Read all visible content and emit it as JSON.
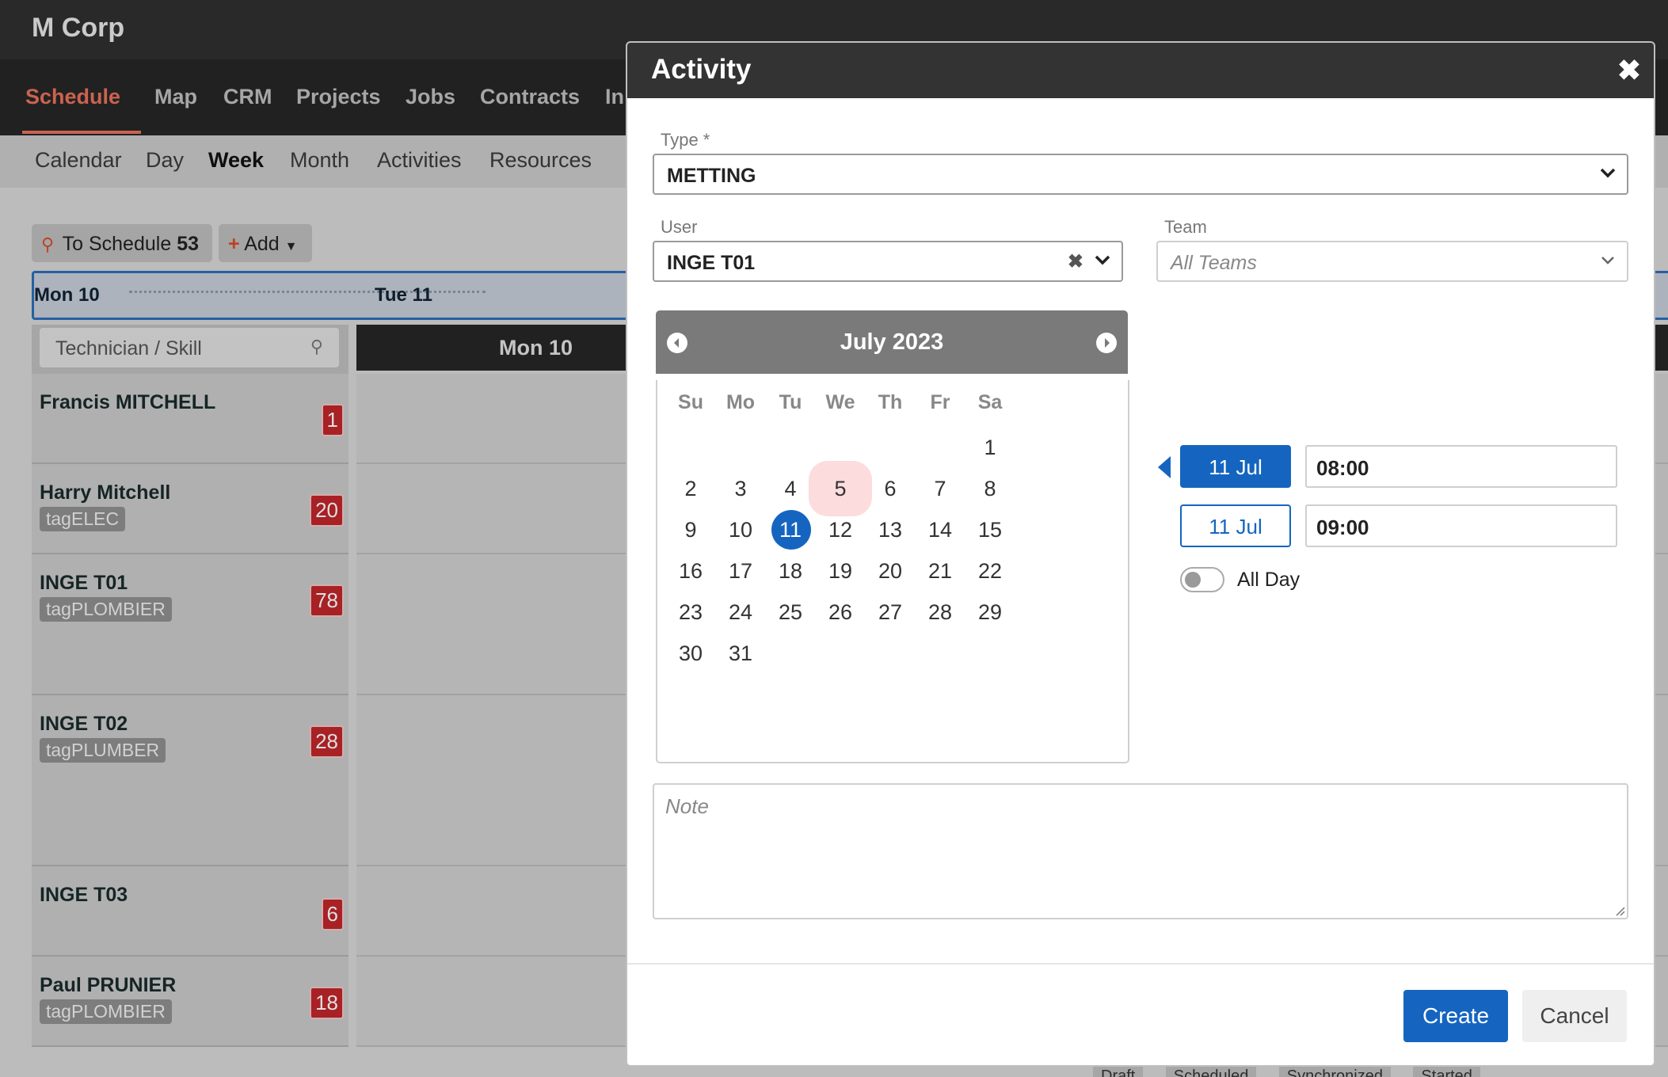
{
  "app": {
    "brand": "M Corp"
  },
  "main_nav": [
    {
      "label": "Schedule",
      "active": true
    },
    {
      "label": "Map"
    },
    {
      "label": "CRM"
    },
    {
      "label": "Projects"
    },
    {
      "label": "Jobs"
    },
    {
      "label": "Contracts"
    },
    {
      "label": "In"
    }
  ],
  "sub_nav": [
    {
      "label": "Calendar"
    },
    {
      "label": "Day"
    },
    {
      "label": "Week",
      "active": true
    },
    {
      "label": "Month"
    },
    {
      "label": "Activities"
    },
    {
      "label": "Resources"
    }
  ],
  "toolbar": {
    "to_schedule_label": "To Schedule",
    "to_schedule_count": "53",
    "add_label": "Add"
  },
  "day_band": {
    "day1": "Mon 10",
    "day2": "Tue 11"
  },
  "tech_search": {
    "placeholder": "Technician / Skill"
  },
  "column_header": "Mon 10",
  "technicians": [
    {
      "name": "Francis MITCHELL",
      "tag": "",
      "count": "1"
    },
    {
      "name": "Harry Mitchell",
      "tag": "tagELEC",
      "count": "20"
    },
    {
      "name": "INGE T01",
      "tag": "tagPLOMBIER",
      "count": "78"
    },
    {
      "name": "INGE T02",
      "tag": "tagPLUMBER",
      "count": "28"
    },
    {
      "name": "INGE T03",
      "tag": "",
      "count": "6"
    },
    {
      "name": "Paul PRUNIER",
      "tag": "tagPLOMBIER",
      "count": "18"
    }
  ],
  "status_legend": [
    "Draft",
    "Scheduled",
    "Synchronized",
    "Started"
  ],
  "modal": {
    "title": "Activity",
    "close_icon": "close-icon",
    "type": {
      "label": "Type *",
      "value": "METTING"
    },
    "user": {
      "label": "User",
      "value": "INGE T01"
    },
    "team": {
      "label": "Team",
      "placeholder": "All Teams"
    },
    "calendar": {
      "title": "July 2023",
      "weekdays": [
        "Su",
        "Mo",
        "Tu",
        "We",
        "Th",
        "Fr",
        "Sa"
      ],
      "days": [
        "1",
        "2",
        "3",
        "4",
        "5",
        "6",
        "7",
        "8",
        "9",
        "10",
        "11",
        "12",
        "13",
        "14",
        "15",
        "16",
        "17",
        "18",
        "19",
        "20",
        "21",
        "22",
        "23",
        "24",
        "25",
        "26",
        "27",
        "28",
        "29",
        "30",
        "31"
      ],
      "first_weekday_index": 6,
      "highlighted_day": "5",
      "selected_day": "11"
    },
    "start": {
      "date": "11 Jul",
      "time": "08:00"
    },
    "end": {
      "date": "11 Jul",
      "time": "09:00"
    },
    "all_day": {
      "label": "All Day",
      "on": false
    },
    "note": {
      "placeholder": "Note"
    },
    "buttons": {
      "create": "Create",
      "cancel": "Cancel"
    }
  },
  "colors": {
    "accent": "#1565c0",
    "nav_active": "#e8715a",
    "badge": "#c0262b",
    "highlight": "#fcdcdc"
  }
}
